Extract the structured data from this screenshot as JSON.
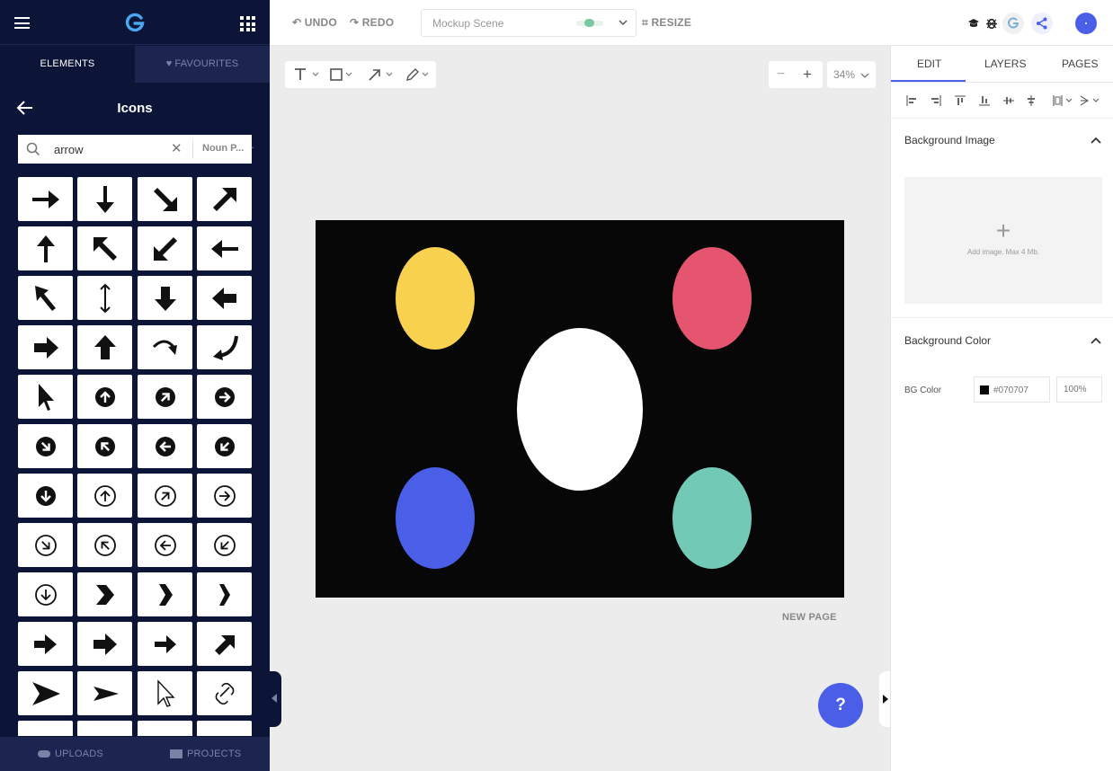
{
  "left_panel": {
    "tabs": {
      "elements": "ELEMENTS",
      "favourites": "FAVOURITES"
    },
    "section_title": "Icons",
    "search": {
      "value": "arrow",
      "provider": "Noun P..."
    },
    "icons": [
      "arrow-right-icon",
      "arrow-down-icon",
      "arrow-down-right-icon",
      "arrow-up-right-icon",
      "arrow-up-icon",
      "arrow-up-left-icon",
      "arrow-down-left-icon",
      "arrow-left-icon",
      "cursor-arrow-icon",
      "double-arrow-vertical-icon",
      "arrow-down-bold-icon",
      "arrow-left-bold-icon",
      "arrow-right-bold-icon",
      "arrow-up-bold-icon",
      "curved-arrow-down-icon",
      "curved-arrow-left-icon",
      "pointer-icon",
      "circle-arrow-up-icon",
      "circle-arrow-up-right-icon",
      "circle-arrow-right-icon",
      "circle-arrow-down-right-icon",
      "circle-arrow-up-left-icon",
      "circle-arrow-left-icon",
      "circle-arrow-down-left-icon",
      "circle-arrow-down-icon",
      "outline-circle-arrow-up-icon",
      "outline-circle-arrow-up-right-icon",
      "outline-circle-arrow-right-icon",
      "outline-circle-arrow-down-right-icon",
      "outline-circle-arrow-up-left-icon",
      "outline-circle-arrow-left-icon",
      "outline-circle-arrow-down-left-icon",
      "outline-circle-arrow-down-icon",
      "chevron-right-wide-icon",
      "chevron-right-thick-icon",
      "chevron-right-narrow-icon",
      "arrow-right-block-icon",
      "arrow-right-heavy-icon",
      "arrow-right-solid-icon",
      "arrow-up-right-heavy-icon",
      "arrowhead-right-icon",
      "arrowhead-right-slim-icon",
      "outline-cursor-icon",
      "link-arrow-icon"
    ],
    "bottom": {
      "uploads": "UPLOADS",
      "projects": "PROJECTS"
    }
  },
  "topbar": {
    "undo": "UNDO",
    "redo": "REDO",
    "scene_name": "Mockup Scene",
    "resize": "RESIZE"
  },
  "canvas": {
    "zoom": "34%",
    "background": "#070707",
    "shapes": [
      {
        "name": "yellow-ellipse",
        "color": "#f8d24f"
      },
      {
        "name": "red-ellipse",
        "color": "#e65570"
      },
      {
        "name": "white-ellipse",
        "color": "#ffffff"
      },
      {
        "name": "blue-ellipse",
        "color": "#4a5ee8"
      },
      {
        "name": "teal-ellipse",
        "color": "#72c9b5"
      }
    ],
    "new_page": "NEW PAGE",
    "help": "?"
  },
  "right_panel": {
    "tabs": {
      "edit": "EDIT",
      "layers": "LAYERS",
      "pages": "PAGES"
    },
    "background_image": {
      "title": "Background Image",
      "hint": "Add image. Max 4 Mb."
    },
    "background_color": {
      "title": "Background Color",
      "label": "BG Color",
      "hex": "#070707",
      "opacity": "100%"
    }
  },
  "colors": {
    "accent": "#4a5ee8",
    "sidebar": "#0c1437"
  }
}
